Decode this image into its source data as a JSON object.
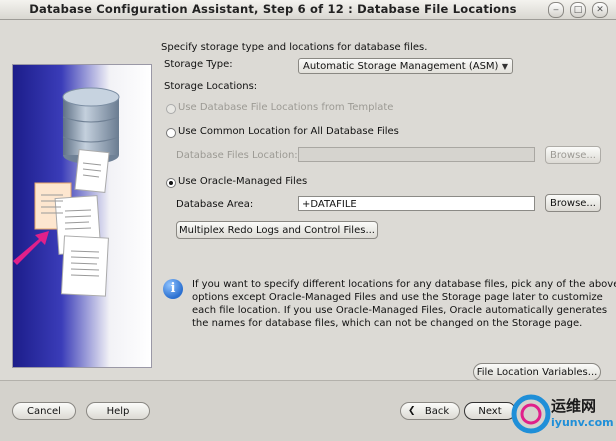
{
  "window": {
    "title": "Database Configuration Assistant, Step 6 of 12 : Database File Locations",
    "controls": [
      "minimize-icon",
      "maximize-icon",
      "close-icon"
    ]
  },
  "main": {
    "instruction": "Specify storage type and locations for database files.",
    "storage_type_label": "Storage Type:",
    "storage_type_value": "Automatic Storage Management (ASM)",
    "storage_locations_label": "Storage Locations:",
    "options": {
      "template": "Use Database File Locations from Template",
      "common": "Use Common Location for All Database Files",
      "omf": "Use Oracle-Managed Files",
      "selected": "omf"
    },
    "db_files_location_label": "Database Files Location:",
    "db_files_location_value": "",
    "db_area_label": "Database Area:",
    "db_area_value": "+DATAFILE",
    "browse_label": "Browse...",
    "multiplex_label": "Multiplex Redo Logs and Control Files...",
    "info_lines": [
      "If you want to specify different locations for any database files, pick any of the above",
      "options except Oracle-Managed Files and use the Storage page later to customize",
      "each file location. If you use Oracle-Managed Files, Oracle automatically generates",
      "the names for database files, which can not be changed on the Storage page."
    ],
    "file_location_variables_label": "File Location Variables..."
  },
  "footer": {
    "cancel_label": "Cancel",
    "help_label": "Help",
    "back_label": "Back",
    "next_label": "Next"
  },
  "watermark": {
    "cn_text": "运维网",
    "url_text": "iyunv.com"
  },
  "colors": {
    "side_panel_blue": "#2a2ca8",
    "info_icon": "#2a6fd0",
    "arrow_magenta": "#e0208a"
  }
}
